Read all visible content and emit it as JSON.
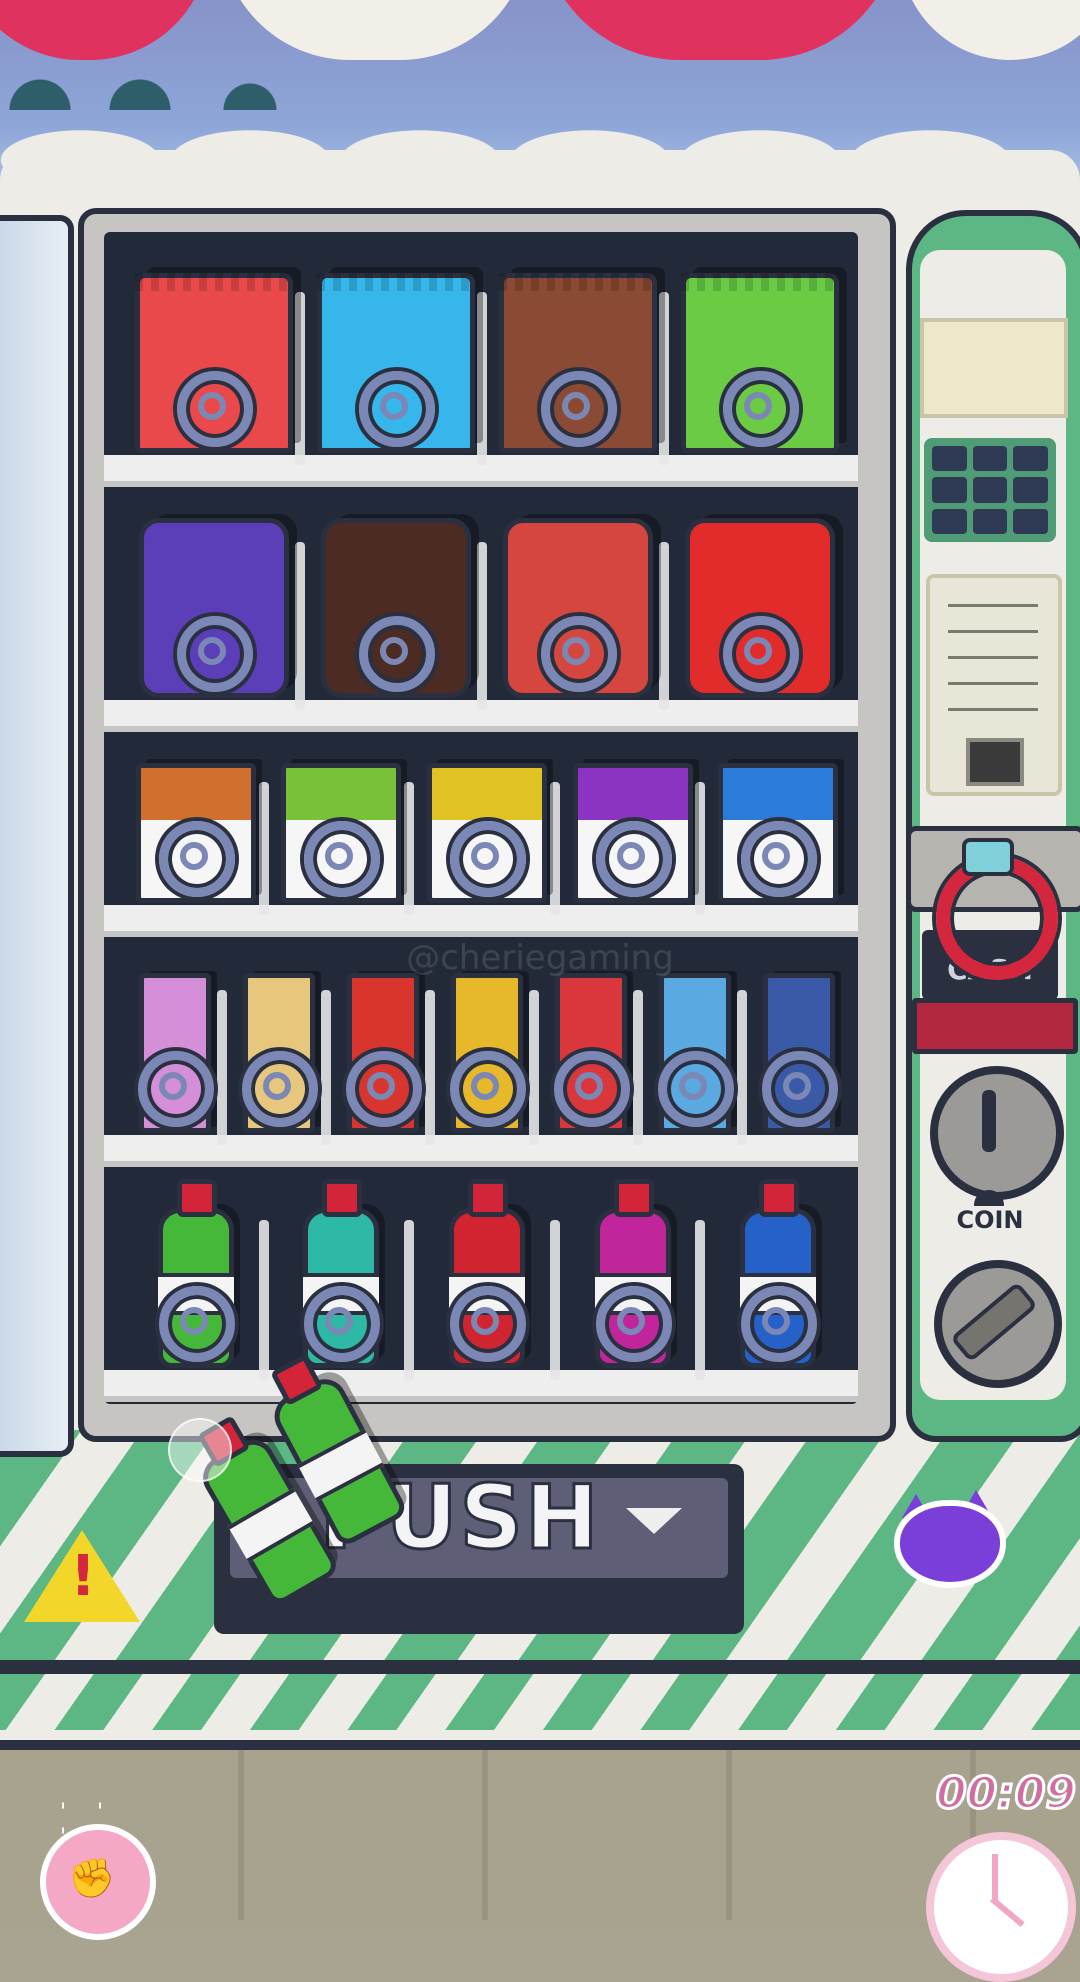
{
  "colors": {
    "machine_body": "#eeece6",
    "machine_green": "#5cb784",
    "interior": "#222a3a",
    "outline": "#2b3040",
    "push_flap": "#5e5f76",
    "timer": "#d16d9f",
    "warning": "#f2d629",
    "accent_red": "#d4273e"
  },
  "push_button": {
    "label": "PUSH"
  },
  "control_panel": {
    "cash_label": "CASH",
    "coin_label": "COIN"
  },
  "timer": {
    "value": "00:09"
  },
  "watermark": "@cheriegaming",
  "icons": {
    "warning": "warning-triangle-icon",
    "cat": "cat-head-icon",
    "clock": "alarm-clock-icon",
    "tap": "tap-hand-icon"
  },
  "shelves": [
    {
      "row": 1,
      "type": "chip-bag",
      "items": [
        {
          "name": "red chips",
          "color": "#e9494a"
        },
        {
          "name": "blue chips",
          "color": "#36b6ea"
        },
        {
          "name": "chili chips",
          "color": "#8a4a34"
        },
        {
          "name": "green chips",
          "color": "#6bcb45"
        }
      ]
    },
    {
      "row": 2,
      "type": "snack-can",
      "items": [
        {
          "name": "purple cookie can",
          "color": "#5b3fb8"
        },
        {
          "name": "marshmallow can",
          "color": "#4b2b22"
        },
        {
          "name": "coffee can",
          "color": "#d4463e"
        },
        {
          "name": "red candy can",
          "color": "#e22c2c"
        }
      ]
    },
    {
      "row": 3,
      "type": "milk-carton",
      "items": [
        {
          "name": "chocolate milk",
          "color": "#d0702e"
        },
        {
          "name": "melon milk",
          "color": "#7ac13a"
        },
        {
          "name": "banana milk",
          "color": "#e0c224"
        },
        {
          "name": "grape milk",
          "color": "#8b34c3"
        },
        {
          "name": "blue milk",
          "color": "#2b7bd9"
        }
      ]
    },
    {
      "row": 4,
      "type": "candy-bar",
      "items": [
        {
          "name": "purple camo bar",
          "color": "#d58fd9"
        },
        {
          "name": "cream bar",
          "color": "#e7c77e"
        },
        {
          "name": "red swirl bar",
          "color": "#d8352f"
        },
        {
          "name": "yellow bar",
          "color": "#e6b82a"
        },
        {
          "name": "red bar",
          "color": "#d9373c"
        },
        {
          "name": "diamond bar",
          "color": "#5aa9e0"
        },
        {
          "name": "striped bar",
          "color": "#3a5aa8"
        }
      ]
    },
    {
      "row": 5,
      "type": "bottle",
      "items": [
        {
          "name": "green soda",
          "color": "#45b83a"
        },
        {
          "name": "teal soda",
          "color": "#2eb8a6"
        },
        {
          "name": "red soda",
          "color": "#d02530"
        },
        {
          "name": "magenta soda",
          "color": "#c0259b"
        },
        {
          "name": "blue soda",
          "color": "#2561c9"
        }
      ]
    }
  ],
  "dispensed": [
    {
      "name": "green soda",
      "color": "#45b83a"
    },
    {
      "name": "green soda",
      "color": "#45b83a"
    }
  ]
}
